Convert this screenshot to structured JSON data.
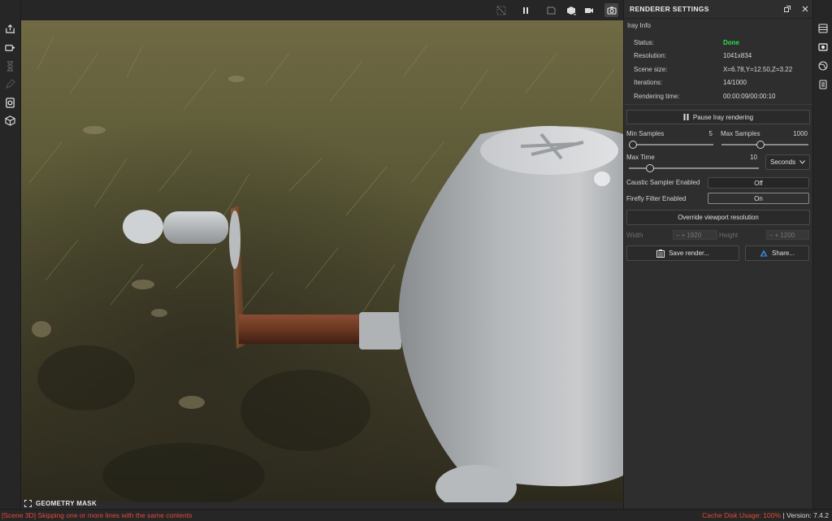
{
  "viewport": {
    "geometry_mask_label": "GEOMETRY MASK"
  },
  "panel": {
    "title": "RENDERER SETTINGS",
    "section_title": "Iray Info",
    "info": [
      {
        "label": "Status:",
        "value": "Done"
      },
      {
        "label": "Resolution:",
        "value": "1041x834"
      },
      {
        "label": "Scene size:",
        "value": "X=6.78,Y=12.50,Z=3.22"
      },
      {
        "label": "Iterations:",
        "value": "14/1000"
      },
      {
        "label": "Rendering time:",
        "value": "00:00:09/00:00:10"
      }
    ],
    "pause_button": "Pause Iray rendering",
    "min_samples": {
      "label": "Min Samples",
      "value": "5",
      "fraction": 0.05
    },
    "max_samples": {
      "label": "Max Samples",
      "value": "1000",
      "fraction": 0.45
    },
    "max_time": {
      "label": "Max Time",
      "value": "10",
      "fraction": 0.16
    },
    "time_unit": "Seconds",
    "caustic": {
      "label": "Caustic Sampler Enabled",
      "value": "Off"
    },
    "firefly": {
      "label": "Firefly Filter Enabled",
      "value": "On"
    },
    "override_button": "Override viewport resolution",
    "width": {
      "label": "Width",
      "value": "1920"
    },
    "height": {
      "label": "Height",
      "value": "1200"
    },
    "save_button": "Save render...",
    "share_button": "Share..."
  },
  "status_bar": {
    "message": "[Scene 3D] Skipping one or more lines with the same contents",
    "cache_label": "Cache Disk Usage:",
    "cache_value": "100%",
    "separator": "|",
    "version": "Version: 7.4.2"
  },
  "colors": {
    "status_done": "#2ee04a",
    "error_red": "#e04b3a"
  }
}
